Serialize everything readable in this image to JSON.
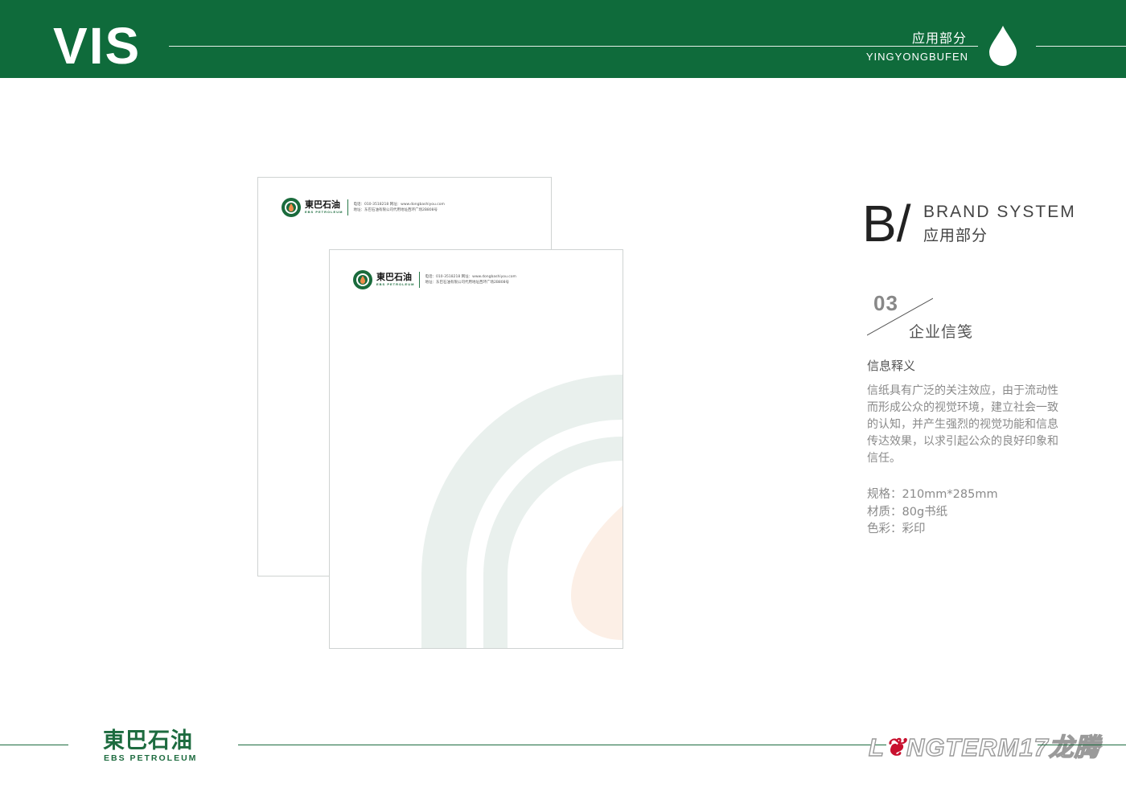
{
  "header": {
    "title": "VIS",
    "section_cn": "应用部分",
    "section_en": "YINGYONGBUFEN",
    "brand_color": "#0f6b3b",
    "icon": "water-drop-icon"
  },
  "letterhead": {
    "company_cn": "東巴石油",
    "company_en": "EBS PETROLEUM",
    "contact_line1": "电话：010-3518218  网址：www.dongbashiyou.com",
    "contact_line2": "地址：东巴石油有限公司代用地址西环广场2B808号",
    "accent_orange": "#f08c4a"
  },
  "panel": {
    "letter": "B/",
    "title_en": "BRAND SYSTEM",
    "title_cn": "应用部分",
    "section_number": "03",
    "section_title": "企业信笺",
    "info_heading": "信息释义",
    "info_text": "信纸具有广泛的关注效应，由于流动性而形成公众的视觉环境，建立社会一致的认知，并产生强烈的视觉功能和信息传达效果，以求引起公众的良好印象和信任。",
    "specs": [
      "规格：210mm*285mm",
      "材质：80g书纸",
      "色彩：彩印"
    ]
  },
  "footer": {
    "logo_cn": "東巴石油",
    "logo_en": "EBS PETROLEUM",
    "page_number": "17",
    "watermark_lead": "L",
    "watermark_mark": "❦",
    "watermark_rest": "NGTERM",
    "watermark_cn": "龙腾"
  }
}
